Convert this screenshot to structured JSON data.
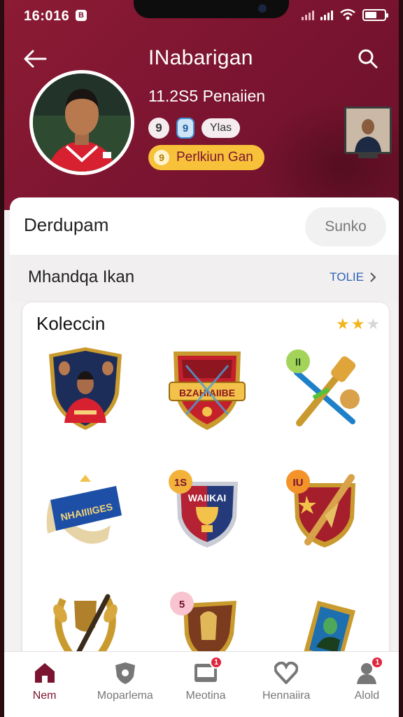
{
  "status_bar": {
    "time": "16:016",
    "app_icon_letter": "B"
  },
  "header": {
    "title": "INabarigan",
    "followers": "11.2S5 Penaiien",
    "badge_one": "9",
    "badge_two": "9",
    "tag": "Ylas",
    "pill_label": "Perlkiun Gan",
    "pill_coin": "9"
  },
  "section": {
    "title": "Derdupam",
    "sort_label": "Sunko"
  },
  "subsection": {
    "title": "Mhandqa Ikan",
    "more_label": "TOLIE"
  },
  "collection": {
    "title": "Koleccin",
    "stars_filled": 2,
    "stars_total": 3,
    "items": [
      {
        "name": "player-shield",
        "label": ""
      },
      {
        "name": "red-crest",
        "label": "BZAHIAIIBE"
      },
      {
        "name": "golden-hammer",
        "badge": "II"
      },
      {
        "name": "blue-banner",
        "label": "NHAIIIIGES"
      },
      {
        "name": "trophy-crest",
        "label": "WAIIKAI",
        "badge": "1S"
      },
      {
        "name": "spear-shield",
        "badge": "IU"
      },
      {
        "name": "laurel-wreath"
      },
      {
        "name": "rocket-shield",
        "badge": "5"
      },
      {
        "name": "framed-card"
      }
    ]
  },
  "bottom_nav": [
    {
      "label": "Nem",
      "icon": "home-icon",
      "active": true
    },
    {
      "label": "Moparlema",
      "icon": "shield-icon"
    },
    {
      "label": "Meotina",
      "icon": "card-icon",
      "badge": "1"
    },
    {
      "label": "Hennaiira",
      "icon": "heart-icon"
    },
    {
      "label": "Alold",
      "icon": "profile-icon",
      "badge": "1"
    }
  ],
  "colors": {
    "brand": "#7a1430",
    "accent": "#f7c13a",
    "link": "#2e62b5"
  }
}
